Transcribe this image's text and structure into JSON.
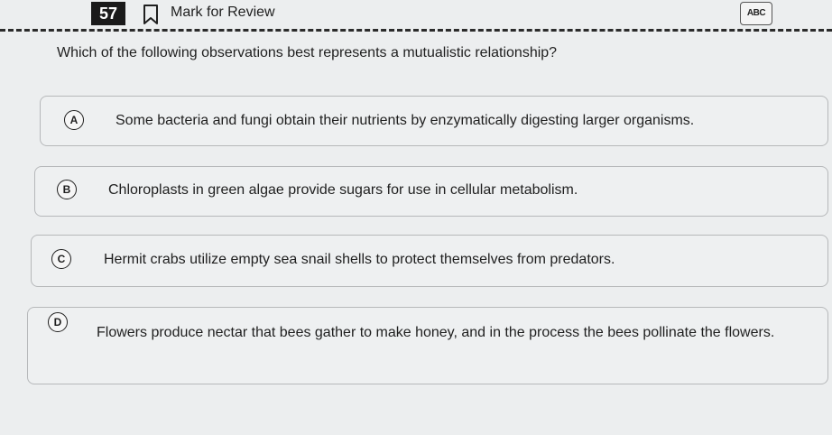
{
  "header": {
    "question_number": "57",
    "mark_for_review_label": "Mark for Review",
    "abc_tool_label": "ABC",
    "bookmark_icon": "bookmark-icon"
  },
  "question": {
    "text": "Which of the following observations best represents a mutualistic relationship?"
  },
  "choices": [
    {
      "letter": "A",
      "text": "Some bacteria and fungi obtain their nutrients by enzymatically digesting larger organisms."
    },
    {
      "letter": "B",
      "text": "Chloroplasts in green algae provide sugars for use in cellular metabolism."
    },
    {
      "letter": "C",
      "text": "Hermit crabs utilize empty sea snail shells to protect themselves from predators."
    },
    {
      "letter": "D",
      "text": "Flowers produce nectar that bees gather to make honey, and in the process the bees pollinate the flowers."
    }
  ]
}
